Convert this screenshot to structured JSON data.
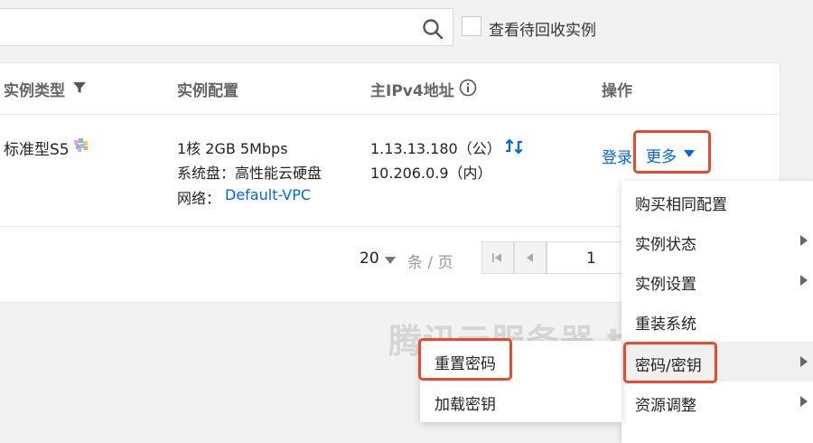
{
  "search": {
    "checkbox_label": "查看待回收实例"
  },
  "table": {
    "headers": {
      "type": "实例类型",
      "config": "实例配置",
      "ip": "主IPv4地址",
      "ops": "操作"
    },
    "row": {
      "type": "标准型S5",
      "config_line1": "1核 2GB 5Mbps",
      "config_line2": "系统盘：高性能云硬盘",
      "network_label": "网络：",
      "network_link": "Default-VPC",
      "ip_public": "1.13.13.180（公）",
      "ip_private": "10.206.0.9（内）",
      "login": "登录",
      "more": "更多"
    }
  },
  "pagination": {
    "page_size": "20",
    "unit": "条 / 页",
    "current_page": "1"
  },
  "menu": {
    "items": [
      {
        "label": "购买相同配置",
        "has_sub": false
      },
      {
        "label": "实例状态",
        "has_sub": true
      },
      {
        "label": "实例设置",
        "has_sub": true
      },
      {
        "label": "重装系统",
        "has_sub": false
      },
      {
        "label": "密码/密钥",
        "has_sub": true
      },
      {
        "label": "资源调整",
        "has_sub": true
      }
    ]
  },
  "submenu": {
    "items": [
      {
        "label": "重置密码"
      },
      {
        "label": "加载密钥"
      }
    ]
  },
  "watermark": "腾讯云服务器 txyiwg.com",
  "colors": {
    "link": "#0066e0",
    "highlight": "#e54b2c"
  }
}
